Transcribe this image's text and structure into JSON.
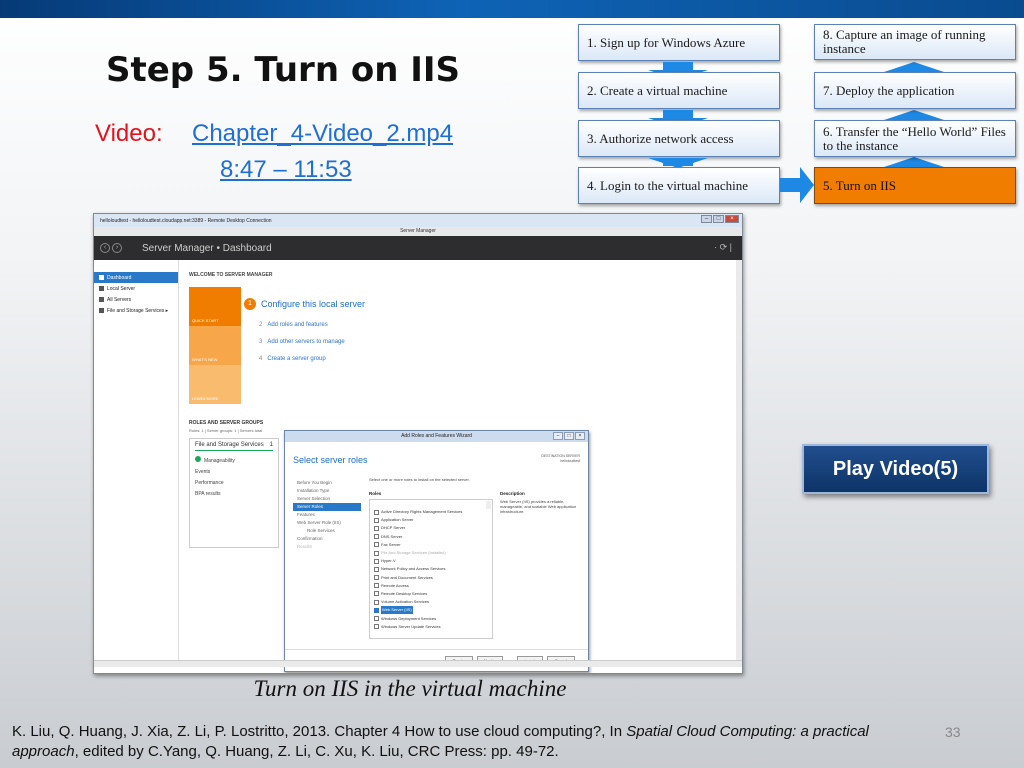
{
  "slide": {
    "title": "Step 5. Turn on IIS",
    "video_label": "Video:",
    "video_link": "Chapter_4-Video_2.mp4",
    "video_time": "8:47 – 11:53",
    "play_button": "Play Video(5)",
    "caption": "Turn on IIS in the virtual machine",
    "citation_prefix": "K. Liu, Q. Huang, J. Xia, Z. Li, P. Lostritto, 2013. Chapter 4 How to use cloud computing?, In ",
    "citation_book": "Spatial Cloud Computing: a practical approach",
    "citation_suffix": ", edited by C.Yang, Q. Huang, Z. Li, C. Xu, K. Liu, CRC Press: pp. 49-72.",
    "page_number": "33"
  },
  "workflow": {
    "steps": [
      "1. Sign up for Windows Azure",
      "2. Create a virtual machine",
      "3. Authorize network access",
      "4. Login to the virtual machine",
      "5. Turn on IIS",
      "6. Transfer the “Hello World” Files to the instance",
      "7. Deploy the application",
      "8. Capture an image of running instance"
    ],
    "active_color": "#f07c00",
    "arrow_color": "#1e88e5"
  },
  "screenshot": {
    "rdp_title": "helloloudtest - helloloudtest.cloudapp.net:3389 - Remote Desktop Connection",
    "window_title": "Server Manager",
    "breadcrumb": "Server Manager • Dashboard",
    "sidebar": [
      "Dashboard",
      "Local Server",
      "All Servers",
      "File and Storage Services ▸"
    ],
    "welcome": "WELCOME TO SERVER MANAGER",
    "quick_tiles": [
      "QUICK START",
      "WHAT'S NEW",
      "LEARN MORE"
    ],
    "configure_num": "1",
    "configure": "Configure this local server",
    "links": [
      {
        "num": "2",
        "text": "Add roles and features"
      },
      {
        "num": "3",
        "text": "Add other servers to manage"
      },
      {
        "num": "4",
        "text": "Create a server group"
      }
    ],
    "roles_heading": "ROLES AND SERVER GROUPS",
    "roles_sub": "Roles: 1 | Server groups: 1 | Servers total",
    "tile_title": "File and Storage Services",
    "tile_count": "1",
    "tile_items": [
      "Manageability",
      "Events",
      "Performance",
      "BPA results"
    ],
    "wizard": {
      "title": "Add Roles and Features Wizard",
      "heading": "Select server roles",
      "destination": "DESTINATION SERVER",
      "destination_name": "helloloudtest",
      "nav": [
        "Before You Begin",
        "Installation Type",
        "Server Selection",
        "Server Roles",
        "Features",
        "Web Server Role (IIS)",
        "Role Services",
        "Confirmation",
        "Results"
      ],
      "instruction": "Select one or more roles to install on the selected server.",
      "roles_label": "Roles",
      "roles": [
        "Active Directory Rights Management Services",
        "Application Server",
        "DHCP Server",
        "DNS Server",
        "Fax Server",
        "File And Storage Services (Installed)",
        "Hyper-V",
        "Network Policy and Access Services",
        "Print and Document Services",
        "Remote Access",
        "Remote Desktop Services",
        "Volume Activation Services",
        "Web Server (IIS)",
        "Windows Deployment Services",
        "Windows Server Update Services"
      ],
      "description_label": "Description",
      "description": "Web Server (IIS) provides a reliable, manageable, and scalable Web application infrastructure.",
      "buttons": [
        "< Previous",
        "Next >",
        "Install",
        "Cancel"
      ]
    }
  }
}
